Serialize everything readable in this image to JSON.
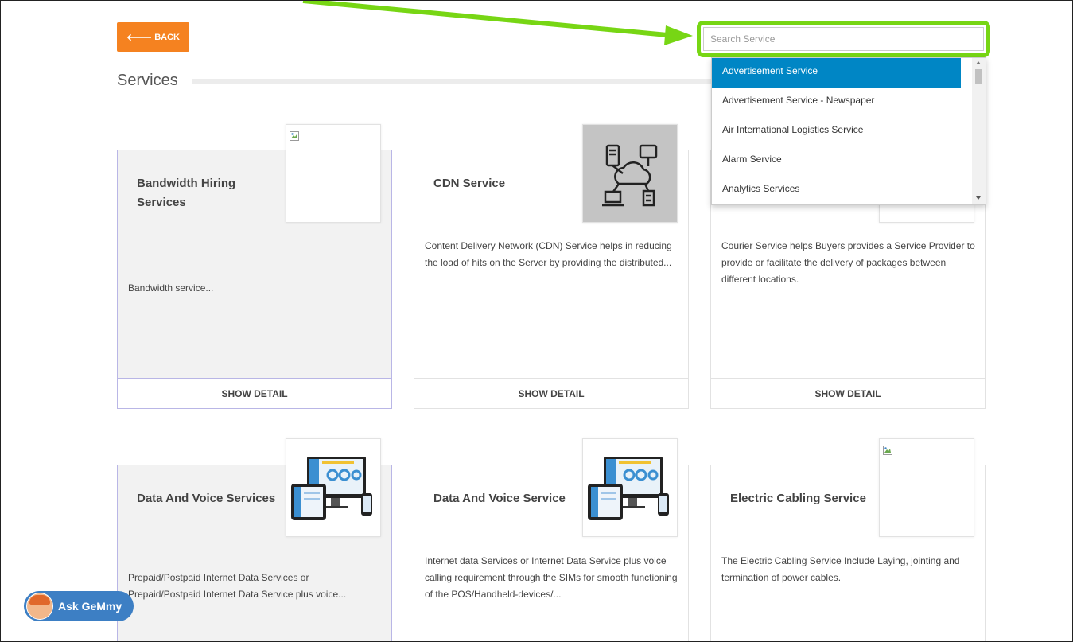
{
  "nav": {
    "back_label": "BACK",
    "back_icon": "arrow-left-icon"
  },
  "page": {
    "title": "Services"
  },
  "search": {
    "placeholder": "Search Service",
    "options": [
      "Advertisement Service",
      "Advertisement Service - Newspaper",
      "Air International Logistics Service",
      "Alarm Service",
      "Analytics Services"
    ],
    "active_option": "Advertisement Service",
    "highlight_color": "#77d614"
  },
  "cards": [
    {
      "title": "Bandwidth Hiring Services",
      "description": "Bandwidth service...",
      "action": "SHOW DETAIL",
      "image": "broken-image-icon"
    },
    {
      "title": "CDN Service",
      "description": "Content Delivery Network (CDN) Service helps in reducing the load of hits on the Server by providing the distributed...",
      "action": "SHOW DETAIL",
      "image": "cloud-network-icon"
    },
    {
      "title": "",
      "description": "Courier Service helps Buyers provides a Service Provider to provide or facilitate the delivery of packages between different locations.",
      "action": "SHOW DETAIL",
      "image": ""
    },
    {
      "title": "Data And Voice Services",
      "description": "Prepaid/Postpaid Internet Data Services or Prepaid/Postpaid Internet Data Service plus voice...",
      "action": "SHOW DETAIL",
      "image": "devices-dashboard-icon"
    },
    {
      "title": "Data And Voice Service",
      "description": "Internet data Services or Internet Data Service plus voice calling requirement through the SIMs for smooth functioning of the POS/Handheld-devices/...",
      "action": "SHOW DETAIL",
      "image": "devices-dashboard-icon"
    },
    {
      "title": "Electric Cabling Service",
      "description": "The Electric Cabling Service Include Laying, jointing and termination of power cables.",
      "action": "SHOW DETAIL",
      "image": "broken-image-icon"
    }
  ],
  "assistant": {
    "label": "Ask GeMmy"
  },
  "colors": {
    "accent": "#f58220",
    "selected": "#0086c5",
    "assistant": "#3d7fc4",
    "annotation": "#77d614"
  }
}
